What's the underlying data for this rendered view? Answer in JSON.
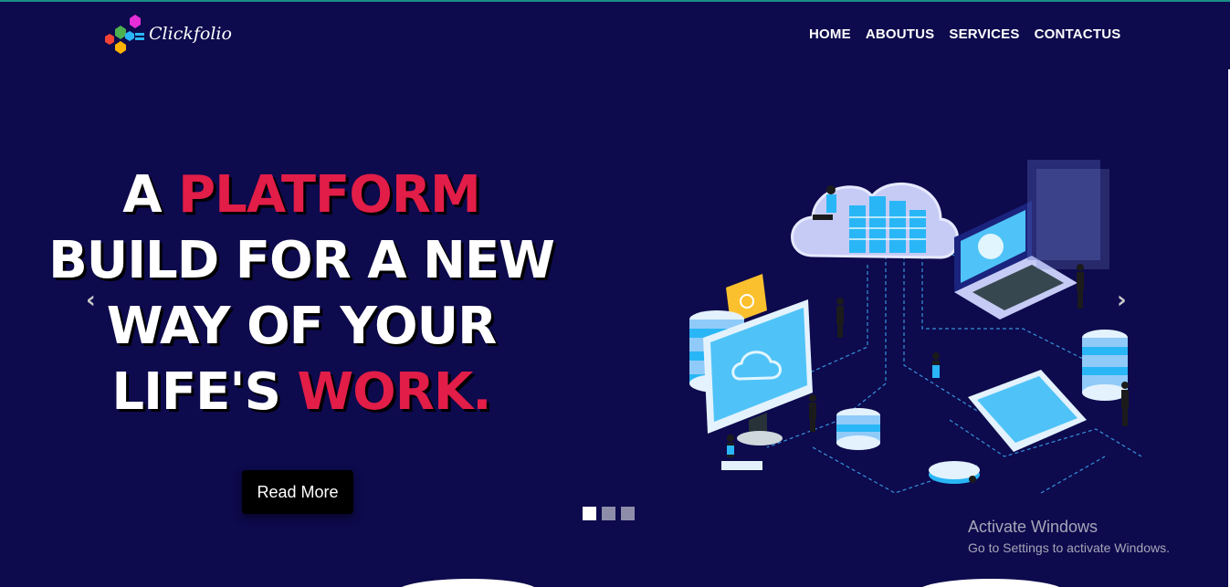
{
  "brand": {
    "name": "Clickfolio"
  },
  "nav": {
    "items": [
      "HOME",
      "ABOUTUS",
      "SERVICES",
      "CONTACTUS"
    ]
  },
  "hero": {
    "line1_a": "A ",
    "line1_b": "PLATFORM",
    "line2": "BUILD FOR A NEW",
    "line3": "WAY OF YOUR",
    "line4_a": "LIFE'S ",
    "line4_b": "WORK.",
    "cta": "Read More"
  },
  "carousel": {
    "slides": 3,
    "active": 1,
    "prev_icon": "chevron-left-icon",
    "next_icon": "chevron-right-icon"
  },
  "watermark": {
    "title": "Activate Windows",
    "subtitle": "Go to Settings to activate Windows."
  },
  "colors": {
    "background": "#0d0a4d",
    "accent": "#e11d48",
    "illustration": "#29b6f6"
  }
}
